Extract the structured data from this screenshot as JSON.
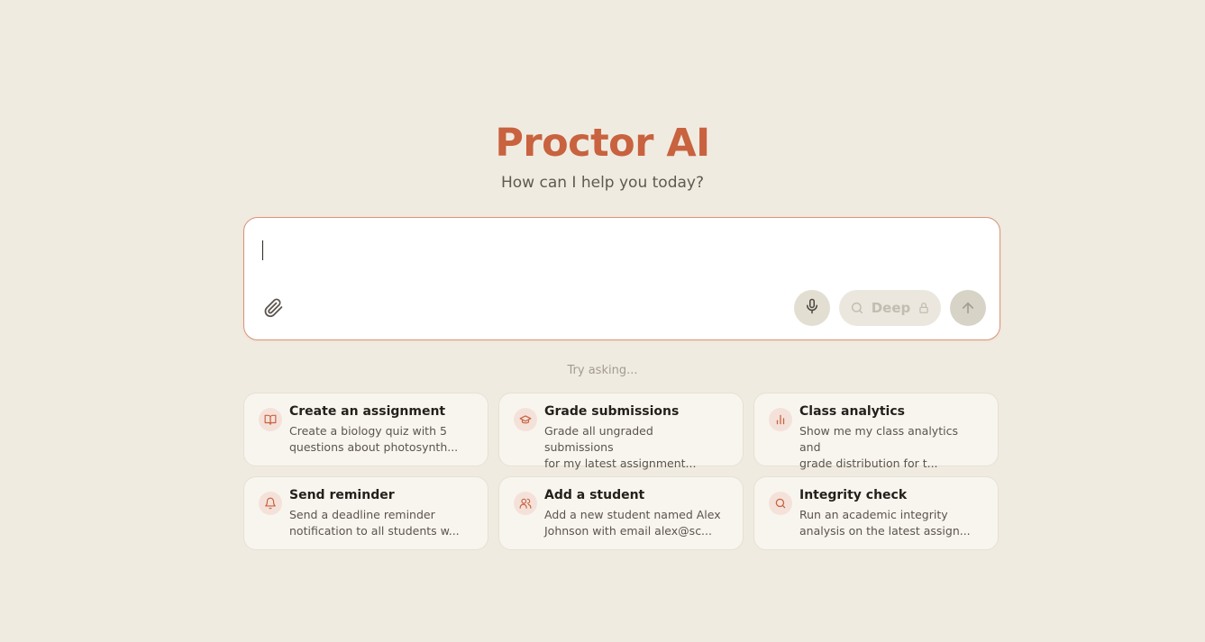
{
  "header": {
    "title": "Proctor AI",
    "subtitle": "How can I help you today?"
  },
  "composer": {
    "input_value": "",
    "attach_icon": "paperclip-icon",
    "mic_icon": "microphone-icon",
    "deep_label": "Deep",
    "deep_icons": [
      "search-icon",
      "lock-icon"
    ],
    "send_icon": "arrow-up-icon"
  },
  "suggestions": {
    "heading": "Try asking...",
    "items": [
      {
        "icon": "book-open-icon",
        "title": "Create an assignment",
        "desc": "Create a biology quiz with 5\nquestions about photosynth..."
      },
      {
        "icon": "graduation-cap-icon",
        "title": "Grade submissions",
        "desc": "Grade all ungraded submissions\nfor my latest assignment..."
      },
      {
        "icon": "bar-chart-icon",
        "title": "Class analytics",
        "desc": "Show me my class analytics and\ngrade distribution for t..."
      },
      {
        "icon": "bell-icon",
        "title": "Send reminder",
        "desc": "Send a deadline reminder\nnotification to all students w..."
      },
      {
        "icon": "users-icon",
        "title": "Add a student",
        "desc": "Add a new student named Alex\nJohnson with email alex@sc..."
      },
      {
        "icon": "search-icon",
        "title": "Integrity check",
        "desc": "Run an academic integrity\nanalysis on the latest assign..."
      }
    ]
  },
  "colors": {
    "accent": "#c8623f",
    "background": "#f0ebe0",
    "card": "#f8f5ef",
    "icon_bg": "#f4e2da"
  }
}
